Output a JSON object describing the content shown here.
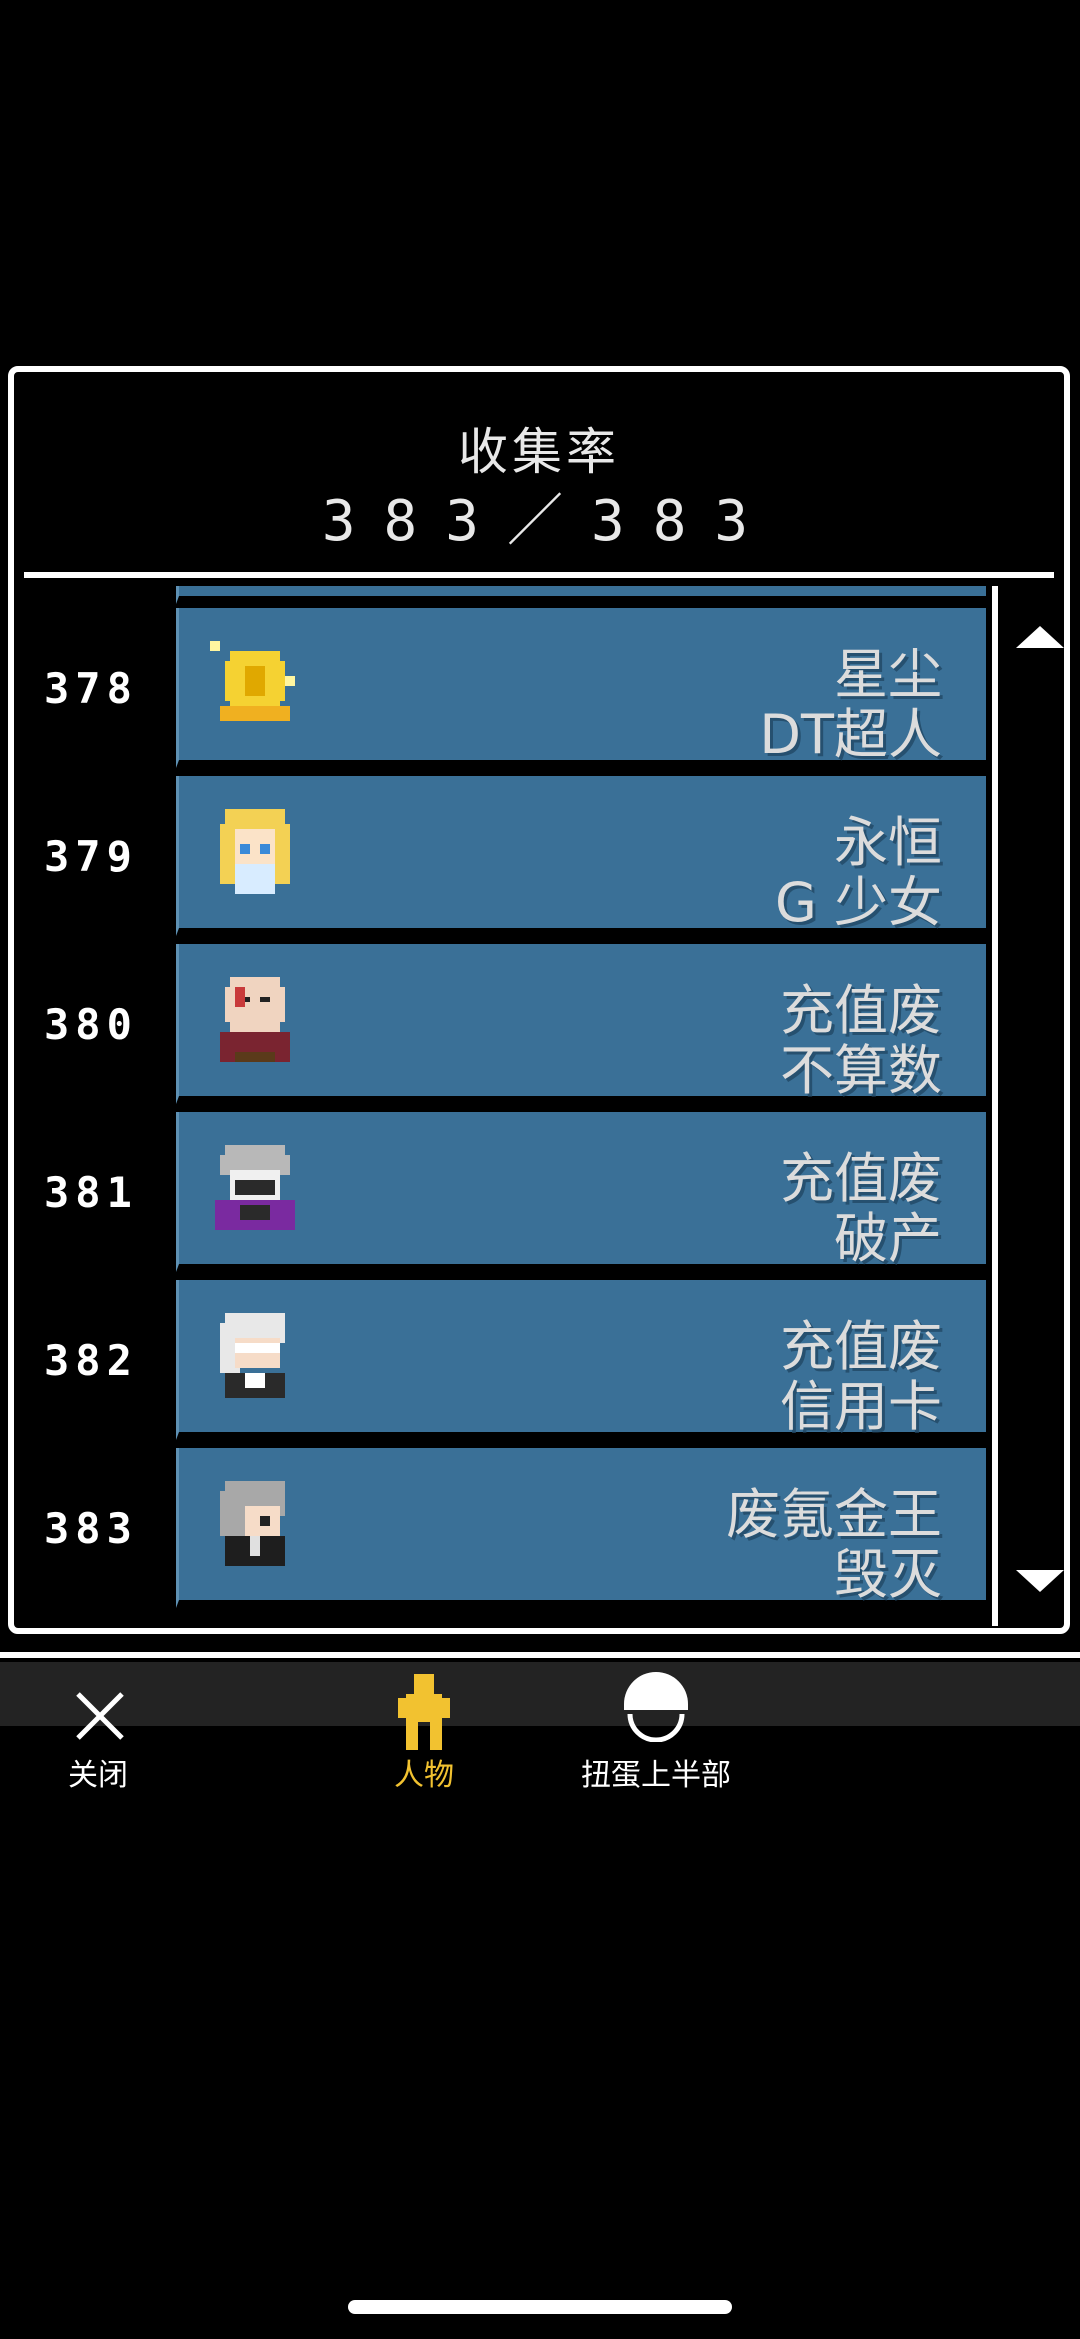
{
  "header": {
    "title": "收集率",
    "count": "383／383"
  },
  "rows": [
    {
      "number": "378",
      "line1": "星尘",
      "line2": "DT超人",
      "icon": "golden-coin-character"
    },
    {
      "number": "379",
      "line1": "永恒",
      "line2": "G 少女",
      "icon": "blonde-girl-character"
    },
    {
      "number": "380",
      "line1": "充值废",
      "line2": "不算数",
      "icon": "bald-old-man-character"
    },
    {
      "number": "381",
      "line1": "充值废",
      "line2": "破产",
      "icon": "masked-purple-character"
    },
    {
      "number": "382",
      "line1": "充值废",
      "line2": "信用卡",
      "icon": "white-hair-bandaged-character"
    },
    {
      "number": "383",
      "line1": "废氪金王",
      "line2": "毁灭",
      "icon": "gray-hair-character"
    }
  ],
  "nav": {
    "close_label": "关闭",
    "characters_label": "人物",
    "egg_label": "扭蛋上半部"
  },
  "colors": {
    "card": "#3a7097",
    "active_tab": "#f2c230",
    "background": "#000000"
  }
}
